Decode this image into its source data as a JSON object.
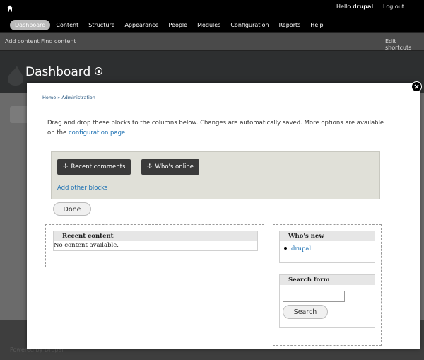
{
  "toolbar": {
    "hello_prefix": "Hello",
    "user_name": "drupal",
    "logout": "Log out",
    "menu": [
      {
        "label": "Dashboard",
        "active": true
      },
      {
        "label": "Content"
      },
      {
        "label": "Structure"
      },
      {
        "label": "Appearance"
      },
      {
        "label": "People"
      },
      {
        "label": "Modules"
      },
      {
        "label": "Configuration"
      },
      {
        "label": "Reports"
      },
      {
        "label": "Help"
      }
    ]
  },
  "shortcuts": {
    "add_content": "Add content",
    "find_content": "Find content",
    "edit_shortcuts": "Edit shortcuts"
  },
  "page": {
    "title": "Dashboard",
    "footer_text": "Powered by Drupal"
  },
  "dialog": {
    "breadcrumb": {
      "home": "Home",
      "separator": "»",
      "admin": "Administration"
    },
    "description_text": "Drag and drop these blocks to the columns below. Changes are automatically saved. More options are available on the",
    "description_link": "configuration page",
    "description_end": ".",
    "tray_blocks": [
      "Recent comments",
      "Who's online"
    ],
    "add_blocks": "Add other blocks",
    "done": "Done",
    "recent_content": {
      "title": "Recent content",
      "body": "No content available."
    },
    "whos_new": {
      "title": "Who's new",
      "users": [
        "drupal"
      ]
    },
    "search_form": {
      "title": "Search form",
      "input_value": "",
      "button": "Search"
    }
  },
  "colors": {
    "toolbar_bg": "#000000",
    "shortcut_bg": "#4a4a4a",
    "link": "#1a6fb2",
    "tray_bg": "#e0e0d8",
    "block_title_bg": "#e6e6e6"
  }
}
